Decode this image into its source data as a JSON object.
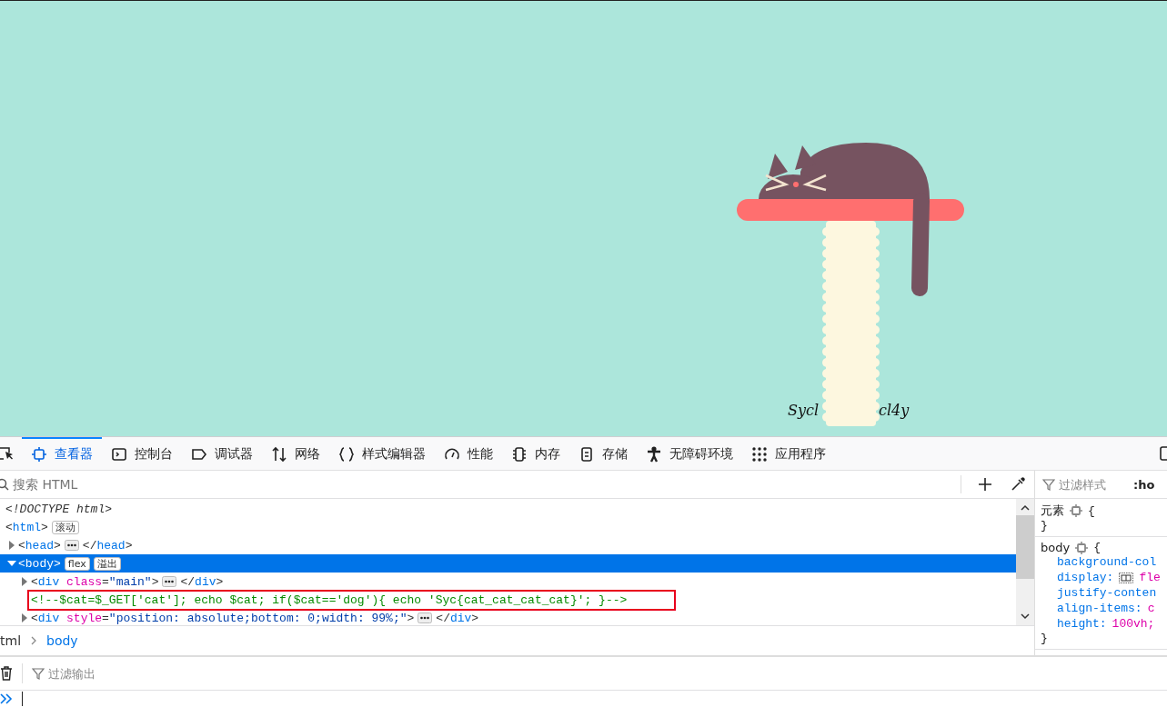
{
  "page": {
    "caption_left": "Sycl",
    "caption_right": "cl4y"
  },
  "devtools": {
    "tabs": [
      {
        "label": "查看器",
        "selected": true
      },
      {
        "label": "控制台",
        "selected": false
      },
      {
        "label": "调试器",
        "selected": false
      },
      {
        "label": "网络",
        "selected": false
      },
      {
        "label": "样式编辑器",
        "selected": false
      },
      {
        "label": "性能",
        "selected": false
      },
      {
        "label": "内存",
        "selected": false
      },
      {
        "label": "存储",
        "selected": false
      },
      {
        "label": "无障碍环境",
        "selected": false
      },
      {
        "label": "应用程序",
        "selected": false
      }
    ],
    "search": {
      "placeholder": "搜索 HTML"
    },
    "tree": [
      {
        "kind": "doctype",
        "text": "<!DOCTYPE html>"
      },
      {
        "kind": "element",
        "open": "<html>",
        "badges": [
          "滚动"
        ],
        "expanded": true,
        "selected": false,
        "children": [
          {
            "kind": "element",
            "open": "<head>",
            "close": "</head>",
            "expanded": false,
            "selected": false
          },
          {
            "kind": "element",
            "open": "<body>",
            "badges": [
              "flex",
              "溢出"
            ],
            "expanded": true,
            "selected": true,
            "children": [
              {
                "kind": "element",
                "open": "<div class=\"main\">",
                "close": "</div>",
                "expanded": false,
                "selected": false
              },
              {
                "kind": "comment",
                "text": "<!--$cat=$_GET['cat']; echo $cat; if($cat=='dog'){ echo 'Syc{cat_cat_cat_cat}'; }-->",
                "highlighted": true
              },
              {
                "kind": "element",
                "open": "<div style=\"position: absolute;bottom: 0;width: 99%;\">",
                "close": "</div>",
                "expanded": false,
                "selected": false
              }
            ]
          }
        ]
      }
    ],
    "breadcrumbs": [
      {
        "label": "tml",
        "selected": false
      },
      {
        "label": "body",
        "selected": true
      }
    ],
    "rules_panel": {
      "filter_placeholder": "过滤样式",
      "pseudo_toggle": ":ho",
      "rules": [
        {
          "selector": "元素",
          "open": "{",
          "close": "}"
        },
        {
          "selector": "body",
          "open": "{",
          "close": "}",
          "declarations": [
            {
              "name": "background-col"
            },
            {
              "name": "display:",
              "value": "fle",
              "flex_icon": true
            },
            {
              "name": "justify-conten"
            },
            {
              "name": "align-items:",
              "value": "c"
            },
            {
              "name": "height:",
              "value": "100vh;"
            }
          ]
        }
      ]
    },
    "console": {
      "filter_placeholder": "过滤输出"
    }
  }
}
